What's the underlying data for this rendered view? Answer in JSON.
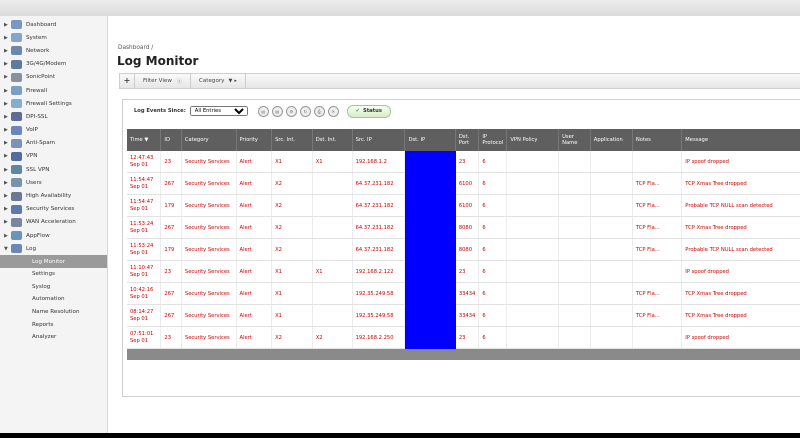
{
  "sidebar": {
    "items": [
      {
        "label": "Dashboard",
        "icon": "dashboard-icon"
      },
      {
        "label": "System",
        "icon": "system-icon"
      },
      {
        "label": "Network",
        "icon": "network-icon"
      },
      {
        "label": "3G/4G/Modem",
        "icon": "modem-icon"
      },
      {
        "label": "SonicPoint",
        "icon": "sonicpoint-icon"
      },
      {
        "label": "Firewall",
        "icon": "firewall-icon"
      },
      {
        "label": "Firewall Settings",
        "icon": "firewall-settings-icon"
      },
      {
        "label": "DPI-SSL",
        "icon": "dpi-ssl-icon"
      },
      {
        "label": "VoIP",
        "icon": "voip-icon"
      },
      {
        "label": "Anti-Spam",
        "icon": "anti-spam-icon"
      },
      {
        "label": "VPN",
        "icon": "vpn-icon"
      },
      {
        "label": "SSL VPN",
        "icon": "ssl-vpn-icon"
      },
      {
        "label": "Users",
        "icon": "users-icon"
      },
      {
        "label": "High Availability",
        "icon": "high-availability-icon"
      },
      {
        "label": "Security Services",
        "icon": "security-services-icon"
      },
      {
        "label": "WAN Acceleration",
        "icon": "wan-acceleration-icon"
      },
      {
        "label": "AppFlow",
        "icon": "appflow-icon"
      },
      {
        "label": "Log",
        "icon": "log-icon"
      }
    ],
    "log_subitems": [
      "Log Monitor",
      "Settings",
      "Syslog",
      "Automation",
      "Name Resolution",
      "Reports",
      "Analyzer"
    ],
    "active_subitem": "Log Monitor"
  },
  "breadcrumb": "Dashboard /",
  "page_title": "Log Monitor",
  "filterbar": {
    "plus": "+",
    "filter_view": "Filter View",
    "category": "Category"
  },
  "toolbar": {
    "events_label": "Log Events Since:",
    "events_value": "All Entries",
    "status_label": "Status"
  },
  "table": {
    "headers": [
      "Time",
      "ID",
      "Category",
      "Priority",
      "Src. Int.",
      "Dst. Int.",
      "Src. IP",
      "Dst. IP",
      "Dst. Port",
      "IP Protocol",
      "VPN Policy",
      "User Name",
      "Application",
      "Notes",
      "Message"
    ],
    "rows": [
      {
        "time": "12:47:43 Sep 01",
        "id": "23",
        "category": "Security Services",
        "priority": "Alert",
        "src_int": "X1",
        "dst_int": "X1",
        "src_ip": "192.168.1.2",
        "dst_port": "23",
        "proto": "6",
        "notes": "",
        "message": "IP spoof dropped"
      },
      {
        "time": "11:54:47 Sep 01",
        "id": "267",
        "category": "Security Services",
        "priority": "Alert",
        "src_int": "X2",
        "dst_int": "",
        "src_ip": "64.37.231.182",
        "dst_port": "6100",
        "proto": "6",
        "notes": "TCP Fla...",
        "message": "TCP Xmas Tree dropped"
      },
      {
        "time": "11:54:47 Sep 01",
        "id": "179",
        "category": "Security Services",
        "priority": "Alert",
        "src_int": "X2",
        "dst_int": "",
        "src_ip": "64.37.231.182",
        "dst_port": "6100",
        "proto": "6",
        "notes": "TCP Fla...",
        "message": "Probable TCP NULL scan detected"
      },
      {
        "time": "11:53:24 Sep 01",
        "id": "267",
        "category": "Security Services",
        "priority": "Alert",
        "src_int": "X2",
        "dst_int": "",
        "src_ip": "64.37.231.182",
        "dst_port": "8080",
        "proto": "6",
        "notes": "TCP Fla...",
        "message": "TCP Xmas Tree dropped"
      },
      {
        "time": "11:53:24 Sep 01",
        "id": "179",
        "category": "Security Services",
        "priority": "Alert",
        "src_int": "X2",
        "dst_int": "",
        "src_ip": "64.37.231.182",
        "dst_port": "8080",
        "proto": "6",
        "notes": "TCP Fla...",
        "message": "Probable TCP NULL scan detected"
      },
      {
        "time": "11:10:47 Sep 01",
        "id": "23",
        "category": "Security Services",
        "priority": "Alert",
        "src_int": "X1",
        "dst_int": "X1",
        "src_ip": "192.168.2.122",
        "dst_port": "23",
        "proto": "6",
        "notes": "",
        "message": "IP spoof dropped"
      },
      {
        "time": "10:42:16 Sep 01",
        "id": "267",
        "category": "Security Services",
        "priority": "Alert",
        "src_int": "X1",
        "dst_int": "",
        "src_ip": "192.35.249.58",
        "dst_port": "33434",
        "proto": "6",
        "notes": "TCP Fla...",
        "message": "TCP Xmas Tree dropped"
      },
      {
        "time": "08:14:27 Sep 01",
        "id": "267",
        "category": "Security Services",
        "priority": "Alert",
        "src_int": "X1",
        "dst_int": "",
        "src_ip": "192.35.249.58",
        "dst_port": "33434",
        "proto": "6",
        "notes": "TCP Fla...",
        "message": "TCP Xmas Tree dropped"
      },
      {
        "time": "07:51:01 Sep 01",
        "id": "23",
        "category": "Security Services",
        "priority": "Alert",
        "src_int": "X2",
        "dst_int": "X2",
        "src_ip": "192.168.2.250",
        "dst_port": "23",
        "proto": "6",
        "notes": "",
        "message": "IP spoof dropped"
      }
    ]
  },
  "colors": {
    "accent": "#cc0000",
    "redaction": "#0000ff",
    "header_bg": "#5f5f5f"
  }
}
